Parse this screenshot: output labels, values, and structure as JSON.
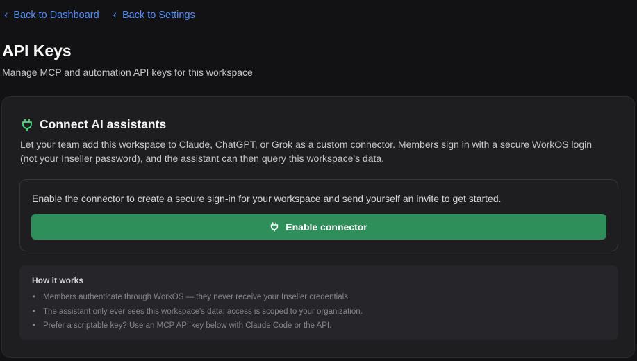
{
  "nav": {
    "back_dashboard": "Back to Dashboard",
    "back_settings": "Back to Settings"
  },
  "header": {
    "title": "API Keys",
    "subtitle": "Manage MCP and automation API keys for this workspace"
  },
  "connect": {
    "icon": "plug-icon",
    "title": "Connect AI assistants",
    "description": "Let your team add this workspace to Claude, ChatGPT, or Grok as a custom connector. Members sign in with a secure WorkOS login (not your Inseller password), and the assistant can then query this workspace's data.",
    "enable_prompt": "Enable the connector to create a secure sign-in for your workspace and send yourself an invite to get started.",
    "enable_button": "Enable connector"
  },
  "how_it_works": {
    "title": "How it works",
    "items": [
      "Members authenticate through WorkOS — they never receive your Inseller credentials.",
      "The assistant only ever sees this workspace's data; access is scoped to your organization.",
      "Prefer a scriptable key? Use an MCP API key below with Claude Code or the API."
    ]
  },
  "colors": {
    "accent_link": "#4f8ff7",
    "button_green": "#2f8f5a",
    "icon_green": "#4ade80",
    "background": "#121214",
    "card": "#1e1e21"
  }
}
